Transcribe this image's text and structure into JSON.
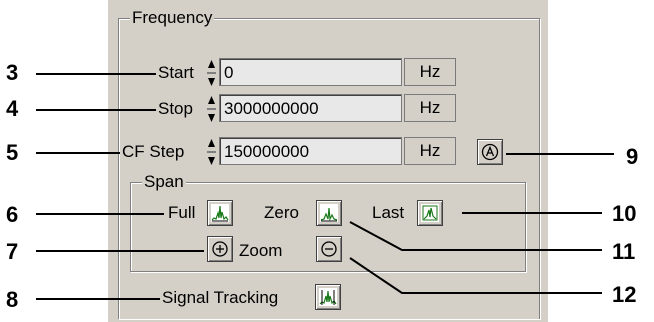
{
  "frequency": {
    "legend": "Frequency",
    "start": {
      "label": "Start",
      "value": "0",
      "unit": "Hz"
    },
    "stop": {
      "label": "Stop",
      "value": "3000000000",
      "unit": "Hz"
    },
    "cf_step": {
      "label": "CF Step",
      "value": "150000000",
      "unit": "Hz"
    }
  },
  "span": {
    "legend": "Span",
    "full_label": "Full",
    "zero_label": "Zero",
    "last_label": "Last",
    "zoom_label": "Zoom"
  },
  "signal_tracking_label": "Signal Tracking",
  "callouts": {
    "c3": "3",
    "c4": "4",
    "c5": "5",
    "c6": "6",
    "c7": "7",
    "c8": "8",
    "c9": "9",
    "c10": "10",
    "c11": "11",
    "c12": "12"
  },
  "icons": {
    "auto": "auto-a-icon",
    "full": "spectrum-full-icon",
    "zero": "spectrum-zero-icon",
    "last": "spectrum-last-icon",
    "zoom_in": "zoom-in-icon",
    "zoom_out": "zoom-out-icon",
    "signal_tracking": "signal-tracking-icon"
  },
  "colors": {
    "panel": "#d4d0c8",
    "field": "#e8e8e8",
    "icon_green": "#1a7a1a"
  }
}
